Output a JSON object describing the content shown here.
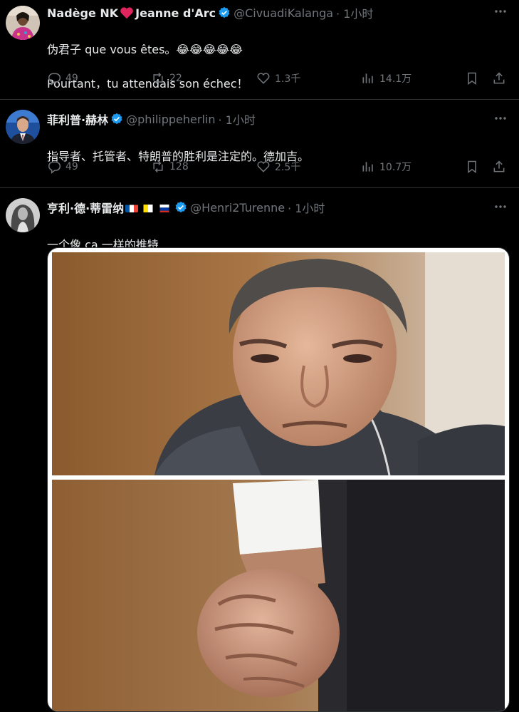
{
  "tweets": [
    {
      "display_name": "Nadège NK",
      "display_name_2": "Jeanne d'Arc",
      "handle": "@CivuadiKalanga",
      "time": "· 1小时",
      "text_line1": "伪君子 que vous êtes。😂😂😂😂😂",
      "text_line2": "Pourtant，tu attendais son échec！",
      "replies": "49",
      "reposts": "22",
      "likes": "1.3千",
      "views": "14.1万"
    },
    {
      "display_name": "菲利普·赫林",
      "handle": "@philippeherlin",
      "time": "· 1小时",
      "text_line1": "指导者、托管者、特朗普的胜利是注定的。德加吉。",
      "replies": "49",
      "reposts": "128",
      "likes": "2.5千",
      "views": "10.7万"
    },
    {
      "display_name": "亨利·德·蒂雷纳",
      "handle": "@Henri2Turenne",
      "time": "· 1小时",
      "text_line1": "一个像 ca 一样的推特"
    }
  ],
  "icons": {
    "verified": "verified-badge-icon",
    "reply": "reply-icon",
    "repost": "repost-icon",
    "like": "like-icon",
    "views": "views-icon",
    "bookmark": "bookmark-icon",
    "share": "share-icon",
    "more": "more-icon"
  },
  "colors": {
    "verified": "#1d9bf0",
    "heart": "#e0245e",
    "muted": "#71767b"
  }
}
